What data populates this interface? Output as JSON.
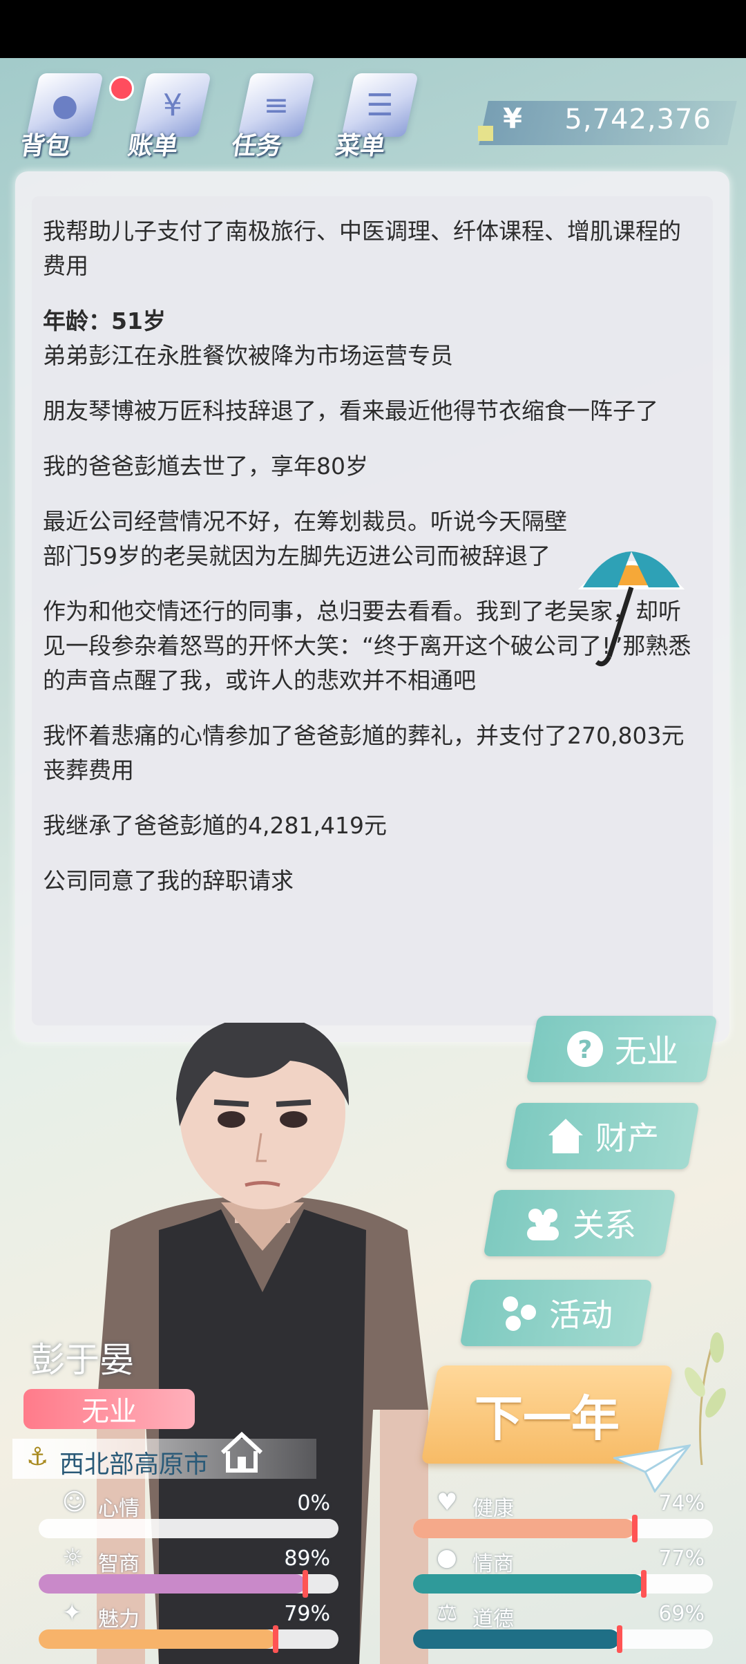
{
  "top_menu": {
    "items": [
      {
        "label": "背包",
        "icon": "backpack-icon",
        "has_badge": true
      },
      {
        "label": "账单",
        "icon": "bill-icon",
        "has_badge": false
      },
      {
        "label": "任务",
        "icon": "task-icon",
        "has_badge": false
      },
      {
        "label": "菜单",
        "icon": "menu-icon",
        "has_badge": false
      }
    ],
    "money_symbol": "¥",
    "money": "5,742,376"
  },
  "log": {
    "entries": [
      "我帮助儿子支付了南极旅行、中医调理、纤体课程、增肌课程的费用",
      "年龄：51岁",
      "弟弟彭江在永胜餐饮被降为市场运营专员",
      "朋友琴博被万匠科技辞退了，看来最近他得节衣缩食一阵子了",
      "我的爸爸彭馗去世了，享年80岁",
      "最近公司经营情况不好，在筹划裁员。听说今天隔壁部门59岁的老吴就因为左脚先迈进公司而被辞退了",
      "作为和他交情还行的同事，总归要去看看。我到了老吴家，却听见一段参杂着怒骂的开怀大笑：“终于离开这个破公司了!”那熟悉的声音点醒了我，或许人的悲欢并不相通吧",
      "我怀着悲痛的心情参加了爸爸彭馗的葬礼，并支付了270,803元丧葬费用",
      "我继承了爸爸彭馗的4,281,419元",
      "公司同意了我的辞职请求"
    ]
  },
  "actions": {
    "job": "无业",
    "property": "财产",
    "relations": "关系",
    "activities": "活动",
    "next_year": "下一年"
  },
  "character": {
    "name": "彭于晏",
    "status": "无业",
    "location": "西北部高原市"
  },
  "stats": [
    {
      "label": "心情",
      "value": "0%",
      "level": 0,
      "icon": "mood-icon",
      "color": "#bfe7df"
    },
    {
      "label": "健康",
      "value": "74%",
      "level": 74,
      "icon": "health-heart-icon",
      "color": "#f5a98a"
    },
    {
      "label": "智商",
      "value": "89%",
      "level": 89,
      "icon": "intelligence-bulb-icon",
      "color": "#c989c9"
    },
    {
      "label": "情商",
      "value": "77%",
      "level": 77,
      "icon": "eq-apple-icon",
      "color": "#2f9a9a"
    },
    {
      "label": "魅力",
      "value": "79%",
      "level": 79,
      "icon": "charm-star-icon",
      "color": "#f7b36a"
    },
    {
      "label": "道德",
      "value": "69%",
      "level": 69,
      "icon": "morality-scale-icon",
      "color": "#1f6f86"
    }
  ]
}
